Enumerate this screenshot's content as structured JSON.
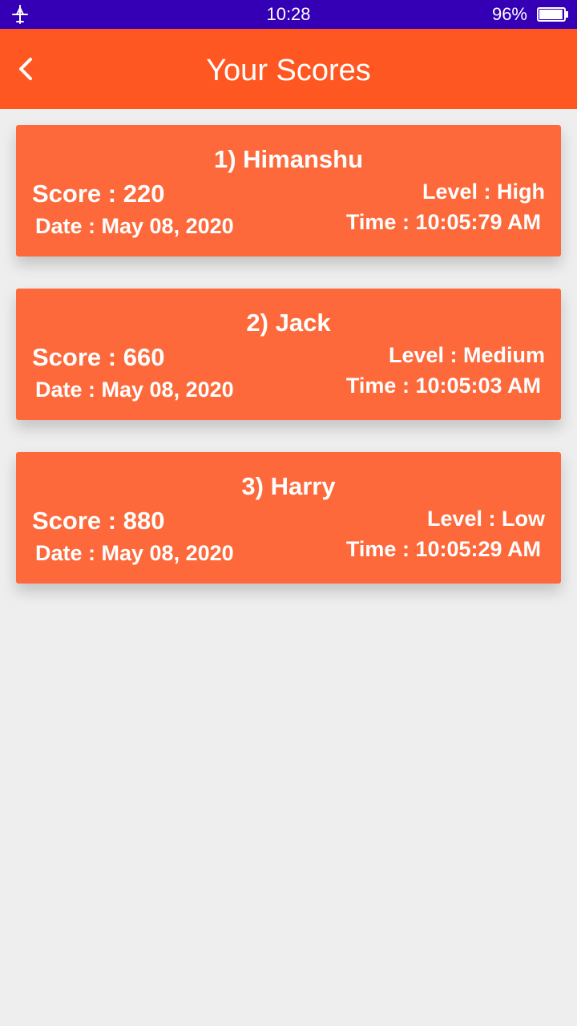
{
  "status_bar": {
    "time": "10:28",
    "battery_percent": "96%",
    "battery_level": 0.96,
    "icons": [
      "airplane-icon",
      "battery-icon"
    ]
  },
  "app_bar": {
    "title": "Your Scores",
    "back_icon": "chevron-left-icon",
    "color": "#ff5722"
  },
  "colors": {
    "status_bar": "#3500b5",
    "card": "#fd693b",
    "background": "#eeeeee",
    "text": "#ffffff"
  },
  "scores": [
    {
      "name": "1) Himanshu",
      "score": "Score : 220",
      "level": "Level : High",
      "date": "Date : May 08, 2020",
      "time": "Time : 10:05:79 AM"
    },
    {
      "name": "2) Jack",
      "score": "Score : 660",
      "level": "Level : Medium",
      "date": "Date : May 08, 2020",
      "time": "Time : 10:05:03 AM"
    },
    {
      "name": "3) Harry",
      "score": "Score : 880",
      "level": "Level : Low",
      "date": "Date : May 08, 2020",
      "time": "Time : 10:05:29 AM"
    }
  ]
}
